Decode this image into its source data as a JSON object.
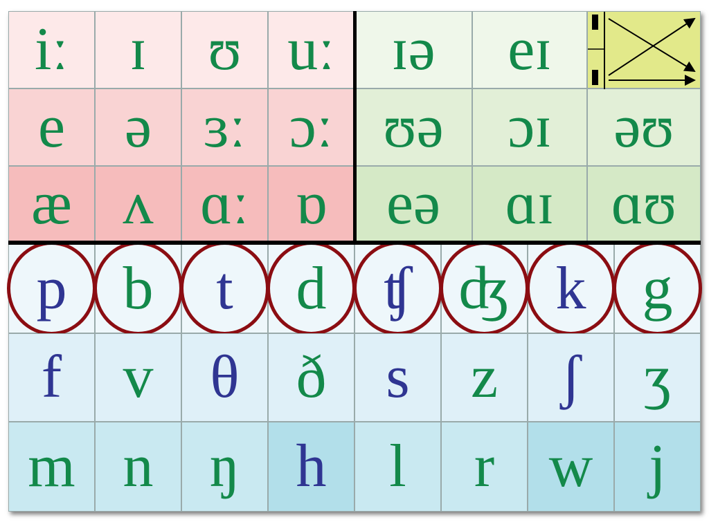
{
  "colors": {
    "voiced": "#13894a",
    "voiceless": "#2f3592",
    "circle": "#8b0d12",
    "monophthong_rows": [
      "#fde9e9",
      "#f9d3d3",
      "#f6bcbc"
    ],
    "diphthong_rows": [
      "#eff7ea",
      "#e2efd7",
      "#d5e9c6"
    ],
    "consonant_rows": [
      "#eef7fb",
      "#dff0f8",
      "#c9e9f1"
    ],
    "consonant_dark": "#b2dfea",
    "indicator": "#e2e98a"
  },
  "monophthongs": [
    [
      {
        "s": "iː",
        "v": "voiced"
      },
      {
        "s": "ɪ",
        "v": "voiced"
      },
      {
        "s": "ʊ",
        "v": "voiced"
      },
      {
        "s": "uː",
        "v": "voiced"
      }
    ],
    [
      {
        "s": "e",
        "v": "voiced"
      },
      {
        "s": "ə",
        "v": "voiced"
      },
      {
        "s": "ɜː",
        "v": "voiced"
      },
      {
        "s": "ɔː",
        "v": "voiced"
      }
    ],
    [
      {
        "s": "æ",
        "v": "voiced"
      },
      {
        "s": "ʌ",
        "v": "voiced"
      },
      {
        "s": "ɑː",
        "v": "voiced"
      },
      {
        "s": "ɒ",
        "v": "voiced"
      }
    ]
  ],
  "diphthongs": [
    [
      {
        "s": "ɪə",
        "v": "voiced"
      },
      {
        "s": "eɪ",
        "v": "voiced"
      }
    ],
    [
      {
        "s": "ʊə",
        "v": "voiced"
      },
      {
        "s": "ɔɪ",
        "v": "voiced"
      },
      {
        "s": "əʊ",
        "v": "voiced"
      }
    ],
    [
      {
        "s": "eə",
        "v": "voiced"
      },
      {
        "s": "ɑɪ",
        "v": "voiced"
      },
      {
        "s": "ɑʊ",
        "v": "voiced"
      }
    ]
  ],
  "indicator_icon": "glide-arrows-icon",
  "consonants": [
    [
      {
        "s": "p",
        "v": "voiceless",
        "circled": true
      },
      {
        "s": "b",
        "v": "voiced",
        "circled": true
      },
      {
        "s": "t",
        "v": "voiceless",
        "circled": true
      },
      {
        "s": "d",
        "v": "voiced",
        "circled": true
      },
      {
        "s": "ʧ",
        "v": "voiceless",
        "circled": true
      },
      {
        "s": "ʤ",
        "v": "voiced",
        "circled": true
      },
      {
        "s": "k",
        "v": "voiceless",
        "circled": true
      },
      {
        "s": "g",
        "v": "voiced",
        "circled": true
      }
    ],
    [
      {
        "s": "f",
        "v": "voiceless"
      },
      {
        "s": "v",
        "v": "voiced"
      },
      {
        "s": "θ",
        "v": "voiceless"
      },
      {
        "s": "ð",
        "v": "voiced"
      },
      {
        "s": "s",
        "v": "voiceless"
      },
      {
        "s": "z",
        "v": "voiced"
      },
      {
        "s": "ʃ",
        "v": "voiceless"
      },
      {
        "s": "ʒ",
        "v": "voiced"
      }
    ],
    [
      {
        "s": "m",
        "v": "voiced"
      },
      {
        "s": "n",
        "v": "voiced"
      },
      {
        "s": "ŋ",
        "v": "voiced"
      },
      {
        "s": "h",
        "v": "voiceless",
        "dark": true
      },
      {
        "s": "l",
        "v": "voiced"
      },
      {
        "s": "r",
        "v": "voiced"
      },
      {
        "s": "w",
        "v": "voiced",
        "dark": true
      },
      {
        "s": "j",
        "v": "voiced",
        "dark": true
      }
    ]
  ]
}
